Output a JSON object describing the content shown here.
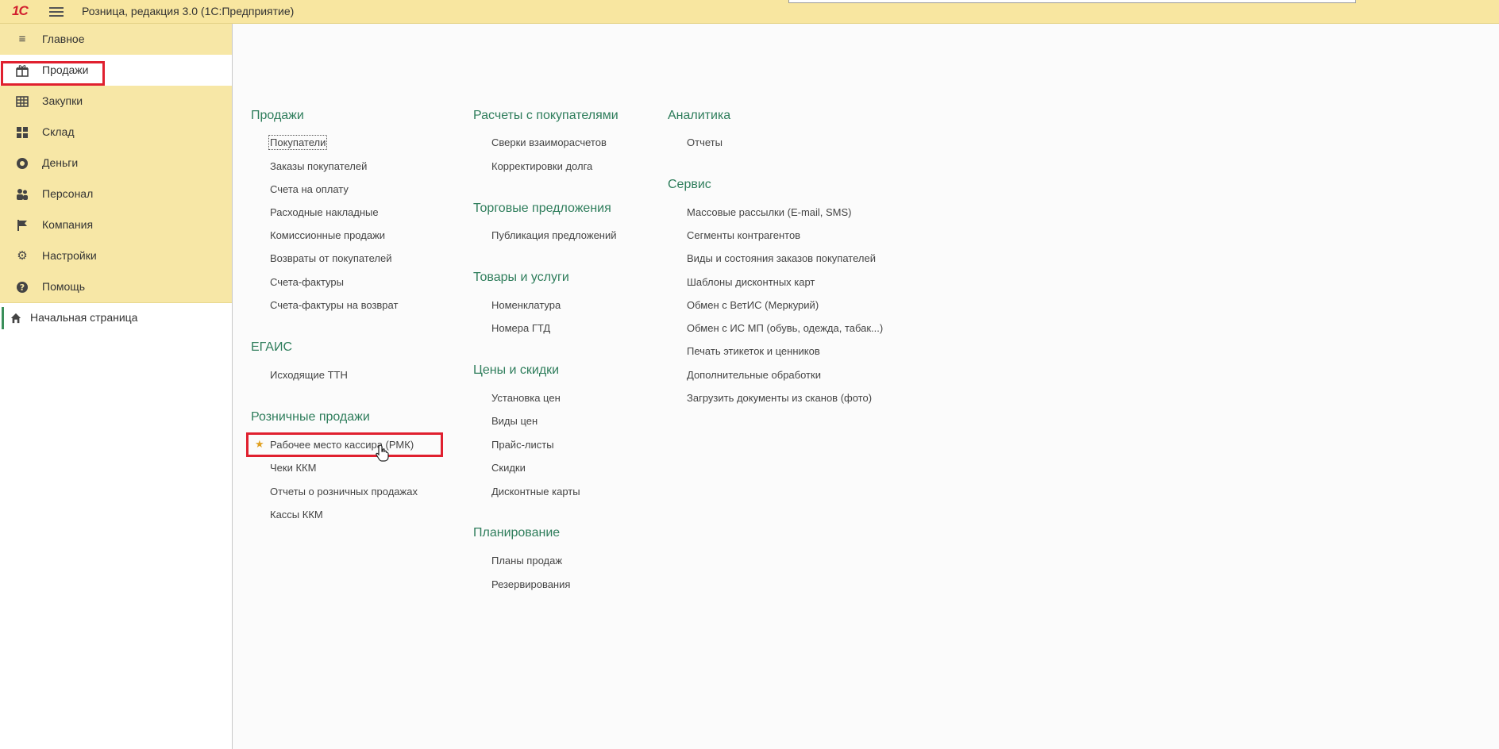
{
  "titlebar": {
    "logo": "1С",
    "title": "Розница, редакция 3.0  (1С:Предприятие)"
  },
  "sidebar": {
    "sections": [
      {
        "label": "Главное",
        "icon": "hamburger-list-icon",
        "glyph": "≡"
      },
      {
        "label": "Продажи",
        "icon": "sales-gift-icon",
        "glyph": "🎁",
        "active": true
      },
      {
        "label": "Закупки",
        "icon": "purchases-grid-icon",
        "glyph": "▦"
      },
      {
        "label": "Склад",
        "icon": "warehouse-blocks-icon",
        "glyph": "▩"
      },
      {
        "label": "Деньги",
        "icon": "money-coin-icon",
        "glyph": "●"
      },
      {
        "label": "Персонал",
        "icon": "staff-people-icon",
        "glyph": "👥"
      },
      {
        "label": "Компания",
        "icon": "company-flag-icon",
        "glyph": "⚑"
      },
      {
        "label": "Настройки",
        "icon": "settings-gear-icon",
        "glyph": "⚙"
      },
      {
        "label": "Помощь",
        "icon": "help-question-icon",
        "glyph": "?"
      }
    ],
    "home": {
      "label": "Начальная страница",
      "icon": "home-icon",
      "glyph": "⌂"
    }
  },
  "content": {
    "col1": {
      "groups": [
        {
          "title": "Продажи",
          "links": [
            "Покупатели",
            "Заказы покупателей",
            "Счета на оплату",
            "Расходные накладные",
            "Комиссионные продажи",
            "Возвраты от покупателей",
            "Счета-фактуры",
            "Счета-фактуры на возврат"
          ]
        },
        {
          "title": "ЕГАИС",
          "links": [
            "Исходящие ТТН"
          ]
        },
        {
          "title": "Розничные продажи",
          "links": [
            "Рабочее место кассира (РМК)",
            "Чеки ККМ",
            "Отчеты о розничных продажах",
            "Кассы ККМ"
          ]
        }
      ]
    },
    "col2": {
      "groups": [
        {
          "title": "Расчеты с покупателями",
          "links": [
            "Сверки взаиморасчетов",
            "Корректировки долга"
          ]
        },
        {
          "title": "Торговые предложения",
          "links": [
            "Публикация предложений"
          ]
        },
        {
          "title": "Товары и услуги",
          "links": [
            "Номенклатура",
            "Номера ГТД"
          ]
        },
        {
          "title": "Цены и скидки",
          "links": [
            "Установка цен",
            "Виды цен",
            "Прайс-листы",
            "Скидки",
            "Дисконтные карты"
          ]
        },
        {
          "title": "Планирование",
          "links": [
            "Планы продаж",
            "Резервирования"
          ]
        }
      ]
    },
    "col3": {
      "groups": [
        {
          "title": "Аналитика",
          "links": [
            "Отчеты"
          ]
        },
        {
          "title": "Сервис",
          "links": [
            "Массовые рассылки (E-mail, SMS)",
            "Сегменты контрагентов",
            "Виды и состояния заказов покупателей",
            "Шаблоны дисконтных карт",
            "Обмен с ВетИС (Меркурий)",
            "Обмен с ИС МП (обувь, одежда, табак...)",
            "Печать этикеток и ценников",
            "Дополнительные обработки",
            "Загрузить документы из сканов (фото)"
          ]
        }
      ]
    }
  },
  "colors": {
    "titlebar_bg": "#f8e6a0",
    "sidebar_bg": "#f7e7a6",
    "group_title": "#2e7d5b",
    "highlight": "#e0202f",
    "star": "#e0a020"
  }
}
